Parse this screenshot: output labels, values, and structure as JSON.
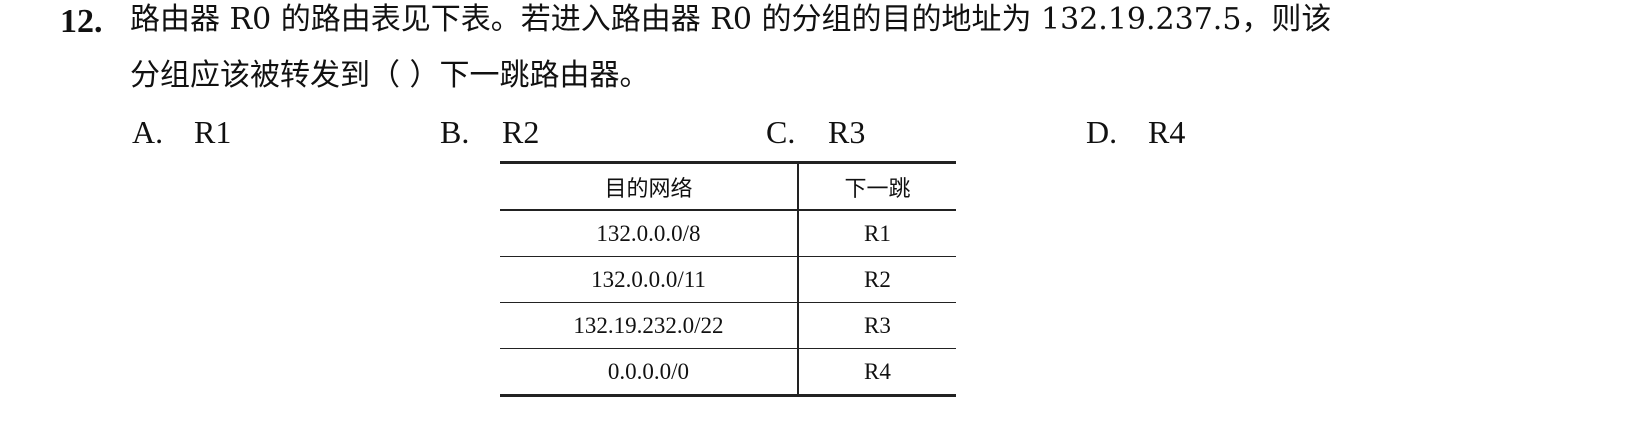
{
  "question": {
    "number": "12.",
    "line1": "路由器 R0 的路由表见下表。若进入路由器 R0 的分组的目的地址为 132.19.237.5，则该",
    "line2": "分组应该被转发到（   ）下一跳路由器。"
  },
  "options": [
    {
      "letter": "A.",
      "text": "R1"
    },
    {
      "letter": "B.",
      "text": "R2"
    },
    {
      "letter": "C.",
      "text": "R3"
    },
    {
      "letter": "D.",
      "text": "R4"
    }
  ],
  "table": {
    "headers": {
      "network": "目的网络",
      "next_hop": "下一跳"
    },
    "rows": [
      {
        "network": "132.0.0.0/8",
        "next_hop": "R1"
      },
      {
        "network": "132.0.0.0/11",
        "next_hop": "R2"
      },
      {
        "network": "132.19.232.0/22",
        "next_hop": "R3"
      },
      {
        "network": "0.0.0.0/0",
        "next_hop": "R4"
      }
    ]
  }
}
